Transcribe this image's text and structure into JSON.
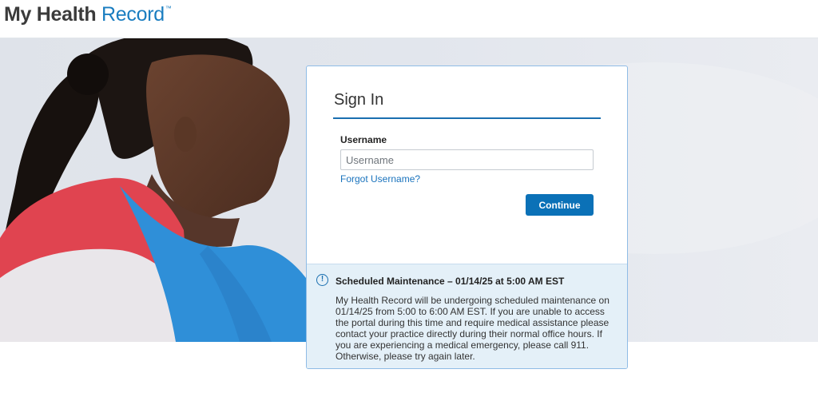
{
  "header": {
    "logo_part1": "My Health",
    "logo_part2": " Record",
    "logo_tm": "™"
  },
  "signin": {
    "title": "Sign In",
    "username_label": "Username",
    "username_value": "",
    "username_placeholder": "Username",
    "forgot_link": "Forgot Username?",
    "continue_label": "Continue"
  },
  "notice": {
    "icon": "info-icon",
    "title": "Scheduled Maintenance – 01/14/25 at 5:00 AM EST",
    "body": "My Health Record will be undergoing scheduled maintenance on 01/14/25 from 5:00 to 6:00 AM EST. If you are unable to access the portal during this time and require medical assistance please contact your practice directly during their normal office hours. If you are experiencing a medical emergency, please call 911. Otherwise, please try again later."
  },
  "colors": {
    "brand_dark": "#3b3b3b",
    "brand_blue": "#1a7dc0",
    "button": "#0b71b7",
    "notice_bg": "#e4f0f8",
    "card_border": "#8fbce6"
  }
}
